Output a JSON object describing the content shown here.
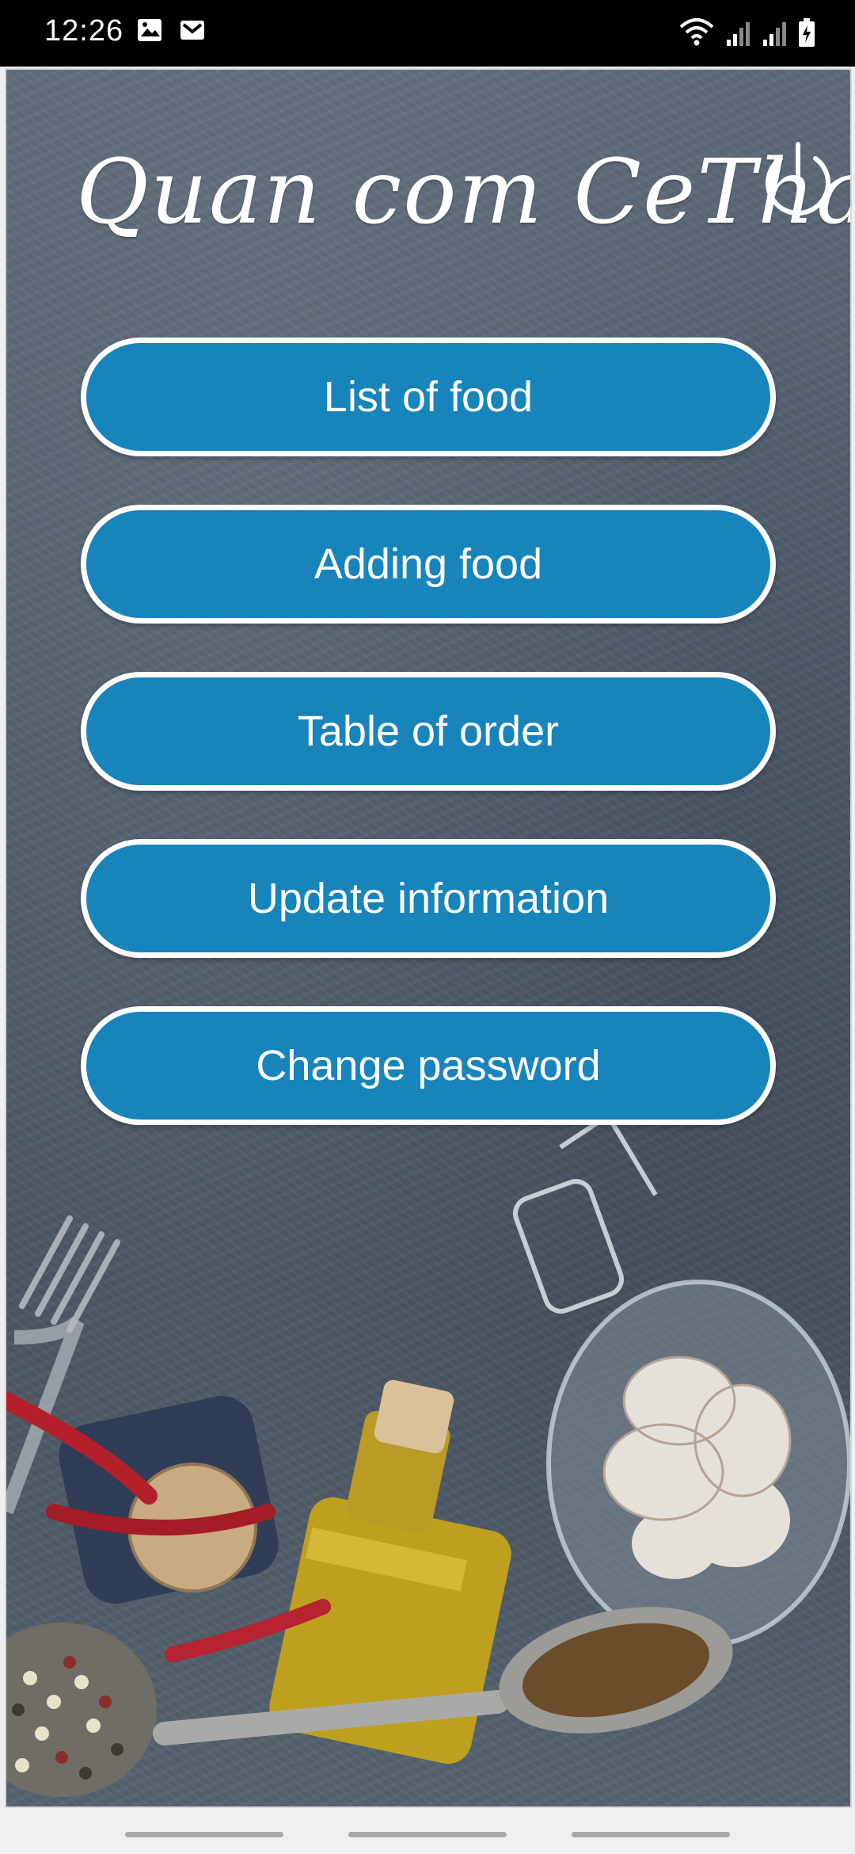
{
  "status_bar": {
    "time": "12:26",
    "left_icons": [
      "image-icon",
      "gmail-icon"
    ],
    "right_icons": [
      "wifi-icon",
      "signal-icon",
      "signal-icon",
      "battery-charging-icon"
    ]
  },
  "app": {
    "title": "Quan com CeThank",
    "power_icon": "power-icon",
    "menu": [
      {
        "label": "List of food"
      },
      {
        "label": "Adding food"
      },
      {
        "label": "Table of order"
      },
      {
        "label": "Update information"
      },
      {
        "label": "Change password"
      }
    ],
    "colors": {
      "button": "#1784bb",
      "button_border": "#ffffff",
      "background": "#56616d"
    }
  },
  "nav_bar": {
    "items": [
      "recent-apps",
      "home",
      "back"
    ]
  }
}
